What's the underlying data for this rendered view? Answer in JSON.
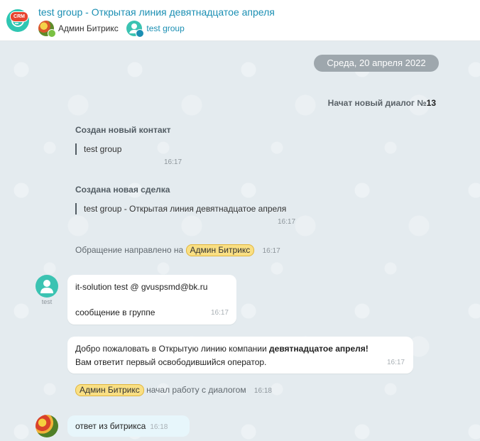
{
  "header": {
    "crm_badge": "CRM",
    "title": "test group - Открытая линия девятнадцатое апреля",
    "members": [
      {
        "name": "Админ Битрикс"
      },
      {
        "name": "test group"
      }
    ]
  },
  "chat": {
    "date_label": "Среда, 20 апреля 2022",
    "new_dialog_prefix": "Начат новый диалог №",
    "new_dialog_number": "13",
    "contact_created": {
      "title": "Создан новый контакт",
      "quote": "test group",
      "time": "16:17"
    },
    "deal_created": {
      "title": "Создана новая сделка",
      "quote": "test group - Открытая линия девятнадцатое апреля",
      "time": "16:17"
    },
    "routed": {
      "text": "Обращение направлено на",
      "mention": "Админ Битрикс",
      "time": "16:17"
    },
    "client_message": {
      "author_label": "test",
      "line1": "it-solution test @ gvuspsmd@bk.ru",
      "line2": "сообщение в группе",
      "time": "16:17"
    },
    "welcome_message": {
      "line1_prefix": "Добро пожаловать в Открытую линию компании ",
      "line1_bold": "девятнадцатое апреля!",
      "line2": "Вам ответит первый освободившийся оператор.",
      "time": "16:17"
    },
    "started": {
      "mention": "Админ Битрикс",
      "text": "начал работу с диалогом",
      "time": "16:18"
    },
    "operator_message": {
      "text": "ответ из битрикса",
      "time": "16:18"
    }
  }
}
